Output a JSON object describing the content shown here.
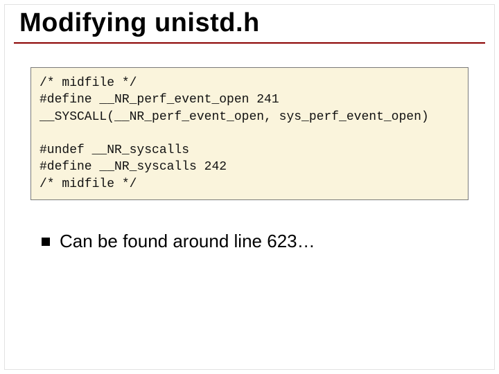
{
  "slide": {
    "title": "Modifying unistd.h",
    "code": {
      "l1": "/* midfile */",
      "l2": "#define __NR_perf_event_open 241",
      "l3": "__SYSCALL(__NR_perf_event_open, sys_perf_event_open)",
      "l4": "#undef __NR_syscalls",
      "l5": "#define __NR_syscalls 242",
      "l6": "/* midfile */"
    },
    "bullet": "Can be found around line 623…"
  }
}
